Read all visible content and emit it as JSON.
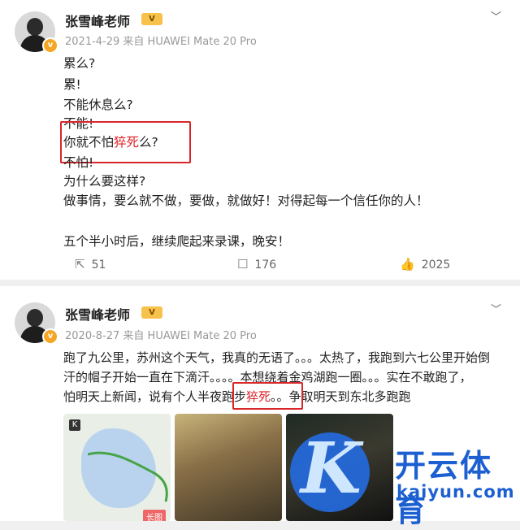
{
  "posts": [
    {
      "username": "张雪峰老师",
      "vip_badge": "V",
      "verified_badge": "v",
      "date": "2021-4-29",
      "source": "来自 HUAWEI Mate 20 Pro",
      "lines": [
        "累么?",
        "累!",
        "不能休息么?",
        "不能!",
        "你就不怕",
        "猝死",
        "么?",
        "不怕!",
        "为什么要这样?",
        "做事情，要么就不做，要做，就做好！对得起每一个信任你的人！",
        "五个半小时后，继续爬起来录课，晚安！"
      ],
      "actions": {
        "repost_count": "51",
        "comment_count": "176",
        "like_count": "2025"
      }
    },
    {
      "username": "张雪峰老师",
      "vip_badge": "V",
      "verified_badge": "v",
      "date": "2020-8-27",
      "source": "来自 HUAWEI Mate 20 Pro",
      "lines": [
        "跑了九公里，苏州这个天气，我真的无语了。。。太热了，我跑到六七公里开始倒",
        "汗的帽子开始一直在下滴汗。。。。本想绕着金鸡湖跑一圈。。。实在不敢跑了，",
        "怕明天上新闻，说有个人半夜跑步",
        "猝死",
        "。。争取明天到东北多跑跑"
      ],
      "map_badge": "K",
      "map_label": "长图"
    }
  ],
  "icons": {
    "chevron": "chevron-down-icon",
    "repost": "repost-icon",
    "comment": "comment-icon",
    "like": "like-icon"
  },
  "watermark": {
    "brand": "开云体育",
    "url": "kaiyun.com"
  },
  "colors": {
    "highlight_red": "#e0232a",
    "watermark_blue": "#1b5fd1"
  }
}
